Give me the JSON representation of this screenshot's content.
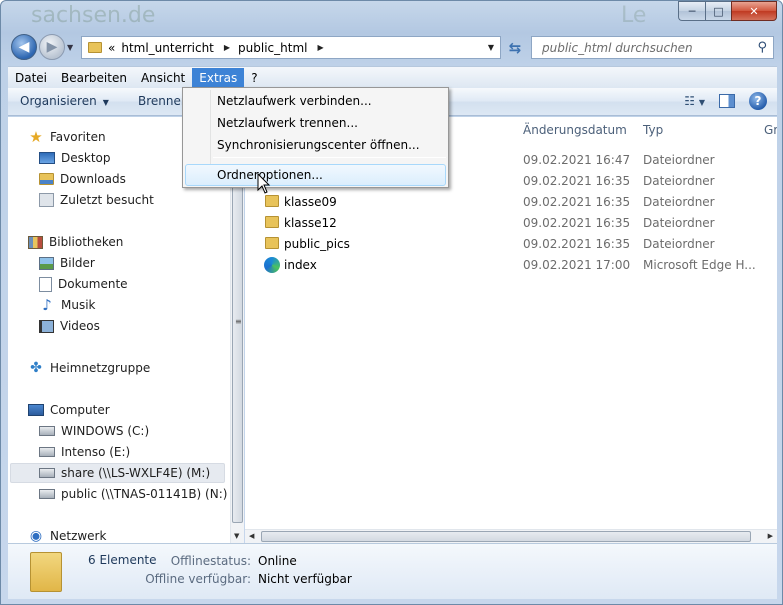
{
  "window": {
    "background_text": "sachsen.de",
    "background_text_right": "Le",
    "caption": {
      "minimize": "─",
      "maximize": "□",
      "close": "✕"
    }
  },
  "nav": {
    "back_icon": "◀",
    "forward_icon": "▶",
    "history_dropdown": "▼"
  },
  "address": {
    "prefix": "«",
    "crumbs": [
      "html_unterricht",
      "public_html"
    ],
    "separator": "▶",
    "dropdown": "▼",
    "refresh_icon": "⇆"
  },
  "search": {
    "placeholder": "public_html durchsuchen",
    "icon": "⚲"
  },
  "menubar": [
    "Datei",
    "Bearbeiten",
    "Ansicht",
    "Extras",
    "?"
  ],
  "toolbar": {
    "organize": "Organisieren",
    "burn": "Brennen",
    "arrow": "▼",
    "view_icon": "☷",
    "view_arrow": "▼",
    "help": "?"
  },
  "navpane": {
    "favorites": {
      "label": "Favoriten",
      "items": [
        "Desktop",
        "Downloads",
        "Zuletzt besucht"
      ]
    },
    "libraries": {
      "label": "Bibliotheken",
      "items": [
        "Bilder",
        "Dokumente",
        "Musik",
        "Videos"
      ]
    },
    "homegroup": "Heimnetzgruppe",
    "computer": {
      "label": "Computer",
      "items": [
        "WINDOWS (C:)",
        "Intenso (E:)",
        "share (\\\\LS-WXLF4E) (M:)",
        "public (\\\\TNAS-01141B) (N:)"
      ]
    },
    "network": "Netzwerk"
  },
  "columns": {
    "date": "Änderungsdatum",
    "type": "Typ",
    "size": "Gr"
  },
  "files": [
    {
      "name": "",
      "date": "09.02.2021 16:47",
      "type": "Dateiordner",
      "kind": "folder"
    },
    {
      "name": "",
      "date": "09.02.2021 16:35",
      "type": "Dateiordner",
      "kind": "folder"
    },
    {
      "name": "klasse09",
      "date": "09.02.2021 16:35",
      "type": "Dateiordner",
      "kind": "folder"
    },
    {
      "name": "klasse12",
      "date": "09.02.2021 16:35",
      "type": "Dateiordner",
      "kind": "folder"
    },
    {
      "name": "public_pics",
      "date": "09.02.2021 16:35",
      "type": "Dateiordner",
      "kind": "folder"
    },
    {
      "name": "index",
      "date": "09.02.2021 17:00",
      "type": "Microsoft Edge H...",
      "kind": "edge"
    }
  ],
  "extras_menu": {
    "items": [
      "Netzlaufwerk verbinden...",
      "Netzlaufwerk trennen...",
      "Synchronisierungscenter öffnen...",
      "Ordneroptionen..."
    ],
    "highlighted_index": 3
  },
  "details": {
    "count": "6 Elemente",
    "offline_status_label": "Offlinestatus:",
    "offline_status_value": "Online",
    "offline_available_label": "Offline verfügbar:",
    "offline_available_value": "Nicht verfügbar"
  },
  "colors": {
    "menu_active": "#3d83d6",
    "folder": "#e8c35a",
    "selection": "#e6eaf0"
  }
}
